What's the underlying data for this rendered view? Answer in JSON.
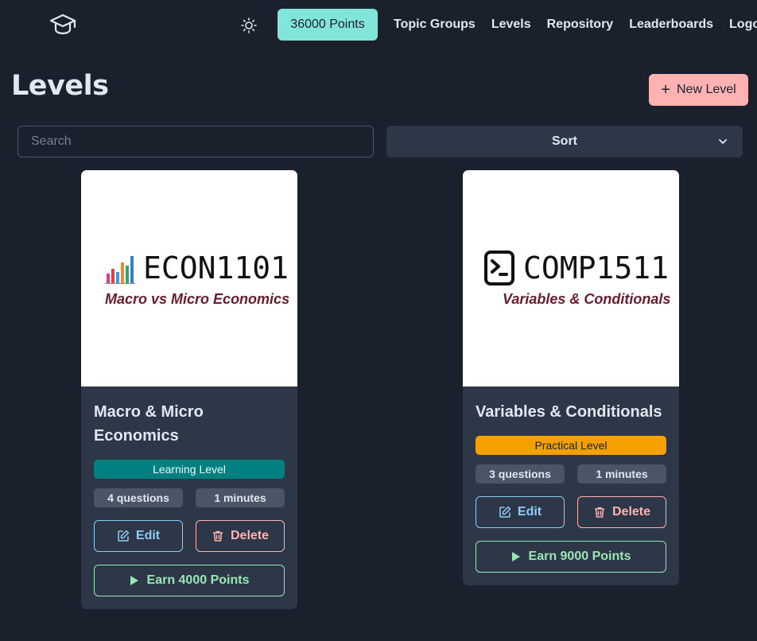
{
  "nav": {
    "points_label": "36000 Points",
    "links": [
      "Topic Groups",
      "Levels",
      "Repository",
      "Leaderboards",
      "Logout"
    ],
    "logo_icon": "graduation-cap-icon",
    "theme_icon": "sun-icon"
  },
  "header": {
    "title": "Levels",
    "new_level_label": "New Level"
  },
  "filters": {
    "search_placeholder": "Search",
    "search_value": "",
    "sort_label": "Sort"
  },
  "levels": [
    {
      "image": {
        "code": "ECON1101",
        "subtitle": "Macro vs Micro Economics",
        "icon": "bar-chart-icon"
      },
      "title": "Macro & Micro Economics",
      "level_type": "Learning Level",
      "questions": "4 questions",
      "duration": "1 minutes",
      "edit_label": "Edit",
      "delete_label": "Delete",
      "earn_label": "Earn 4000 Points"
    },
    {
      "image": {
        "code": "COMP1511",
        "subtitle": "Variables & Conditionals",
        "icon": "terminal-icon"
      },
      "title": "Variables & Conditionals",
      "level_type": "Practical Level",
      "questions": "3 questions",
      "duration": "1 minutes",
      "edit_label": "Edit",
      "delete_label": "Delete",
      "earn_label": "Earn 9000 Points"
    }
  ],
  "colors": {
    "background": "#1a202c",
    "card": "#2d3748",
    "points_accent": "#81e6d9",
    "new_level_accent": "#feb2b2",
    "learning_badge": "#008080",
    "practical_badge": "#f6a000",
    "edit": "#90cdf4",
    "delete": "#feb2b2",
    "earn": "#9ae6b4"
  }
}
